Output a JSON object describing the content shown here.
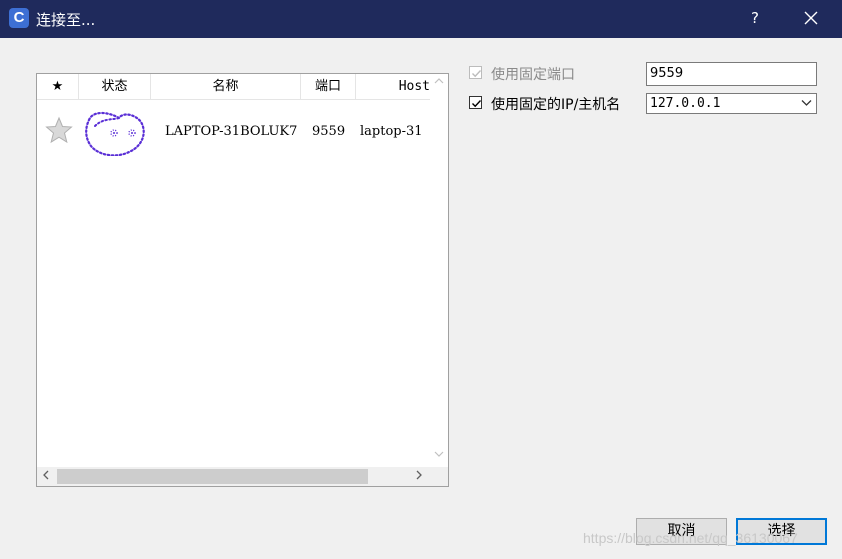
{
  "window": {
    "title": "连接至...",
    "help_label": "?",
    "app_icon_letter": "C"
  },
  "list": {
    "columns": [
      "★",
      "状态",
      "名称",
      "端口",
      "Host"
    ],
    "rows": [
      {
        "favorite_icon": "star-icon",
        "status_icon": "status-face-icon",
        "name": "LAPTOP-31BOLUK7",
        "port": "9559",
        "host": "laptop-31"
      }
    ]
  },
  "options": {
    "fixed_port": {
      "label": "使用固定端口",
      "checked": true,
      "disabled": true,
      "value": "9559"
    },
    "fixed_ip": {
      "label": "使用固定的IP/主机名",
      "checked": true,
      "disabled": false,
      "value": "127.0.0.1"
    }
  },
  "buttons": {
    "cancel": "取消",
    "select": "选择"
  },
  "watermark": "https://blog.csdn.net/qq_36130067"
}
